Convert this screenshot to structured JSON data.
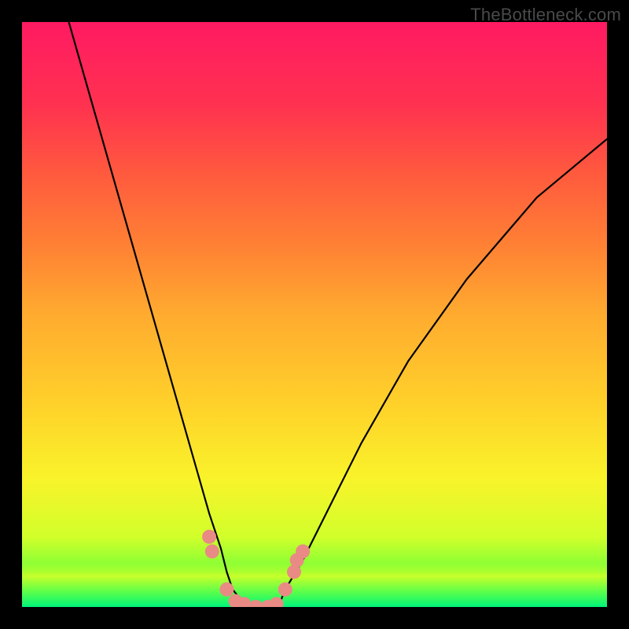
{
  "watermark": "TheBottleneck.com",
  "chart_data": {
    "type": "line",
    "title": "",
    "xlabel": "",
    "ylabel": "",
    "xlim": [
      0,
      100
    ],
    "ylim": [
      0,
      100
    ],
    "grid": false,
    "legend": false,
    "series": [
      {
        "name": "curve",
        "x": [
          8,
          12,
          16,
          20,
          24,
          28,
          30,
          32,
          34,
          35,
          36,
          38,
          40,
          42,
          44,
          45,
          48,
          52,
          58,
          66,
          76,
          88,
          100
        ],
        "values": [
          100,
          86,
          72,
          58,
          44,
          30,
          23,
          16,
          10,
          6,
          3,
          0.5,
          0,
          0,
          0.5,
          3,
          8,
          16,
          28,
          42,
          56,
          70,
          80
        ]
      }
    ],
    "markers": [
      {
        "name": "pink-dot",
        "x": 32.0,
        "y": 12.0
      },
      {
        "name": "pink-dot",
        "x": 32.5,
        "y": 9.5
      },
      {
        "name": "pink-dot",
        "x": 35.0,
        "y": 3.0
      },
      {
        "name": "pink-dot",
        "x": 36.5,
        "y": 1.0
      },
      {
        "name": "pink-dot",
        "x": 38.0,
        "y": 0.5
      },
      {
        "name": "pink-dot",
        "x": 40.0,
        "y": 0.0
      },
      {
        "name": "pink-dot",
        "x": 42.0,
        "y": 0.0
      },
      {
        "name": "pink-dot",
        "x": 43.5,
        "y": 0.5
      },
      {
        "name": "pink-dot",
        "x": 45.0,
        "y": 3.0
      },
      {
        "name": "pink-dot",
        "x": 46.5,
        "y": 6.0
      },
      {
        "name": "pink-dot",
        "x": 47.0,
        "y": 8.0
      },
      {
        "name": "pink-dot",
        "x": 48.0,
        "y": 9.5
      }
    ],
    "marker_style": {
      "color": "#e98a84",
      "radius_px": 9
    }
  }
}
